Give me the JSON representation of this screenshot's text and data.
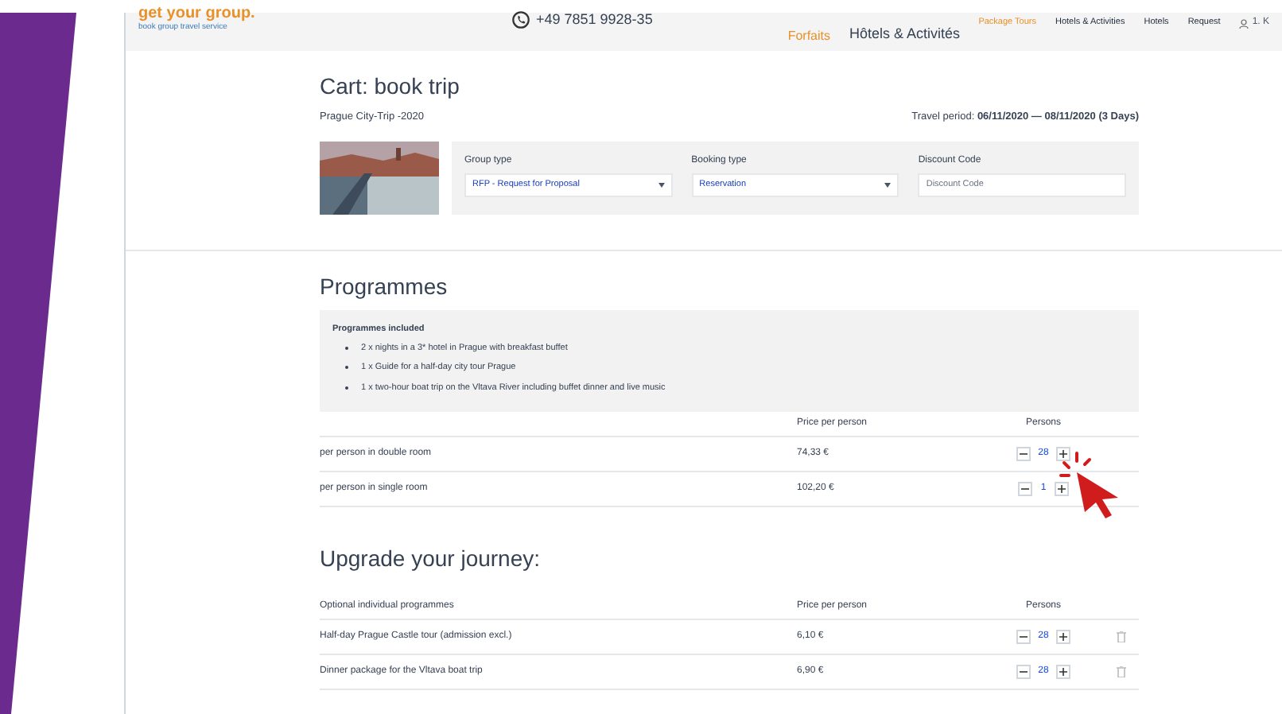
{
  "header": {
    "logo": "get your group.",
    "tagline": "book group travel service",
    "phone": "+49 7851 9928-35",
    "overlay_labels": [
      "Forfaits",
      "Hôtels & Activités"
    ],
    "nav": [
      {
        "label": "Package Tours",
        "selected": true
      },
      {
        "label": "Hotels & Activities",
        "selected": false
      },
      {
        "label": "Hotels",
        "selected": false
      },
      {
        "label": "Request",
        "selected": false
      }
    ],
    "user": "1. K"
  },
  "cart": {
    "title": "Cart: book trip",
    "trip": "Prague City-Trip -2020",
    "travel_period_label": "Travel period:",
    "travel_period": "06/11/2020 — 08/11/2020 (3 Days)",
    "fields": [
      {
        "kind": "select",
        "label": "Group type",
        "value": "RFP - Request for Proposal"
      },
      {
        "kind": "select",
        "label": "Booking type",
        "value": "Reservation"
      },
      {
        "kind": "text",
        "label": "Discount Code",
        "placeholder": "Discount Code"
      }
    ]
  },
  "programmes": {
    "title": "Programmes",
    "included_title": "Programmes included",
    "included": [
      "2 x nights in a 3* hotel in Prague with breakfast buffet",
      "1 x Guide for a half-day city tour Prague",
      "1 x two-hour boat trip on the Vltava River including buffet dinner and live music"
    ],
    "columns": [
      "",
      "Price per person",
      "Persons"
    ],
    "rows": [
      {
        "name": "per person in double room",
        "price": "74,33 €",
        "persons": "28"
      },
      {
        "name": "per person in single room",
        "price": "102,20 €",
        "persons": "1"
      }
    ]
  },
  "upgrade": {
    "title": "Upgrade your journey:",
    "columns": [
      "Optional individual programmes",
      "Price per person",
      "Persons"
    ],
    "rows": [
      {
        "name": "Half-day Prague Castle tour (admission excl.)",
        "price": "6,10 €",
        "persons": "28"
      },
      {
        "name": "Dinner package for the Vltava boat trip",
        "price": "6,90 €",
        "persons": "28"
      }
    ]
  }
}
